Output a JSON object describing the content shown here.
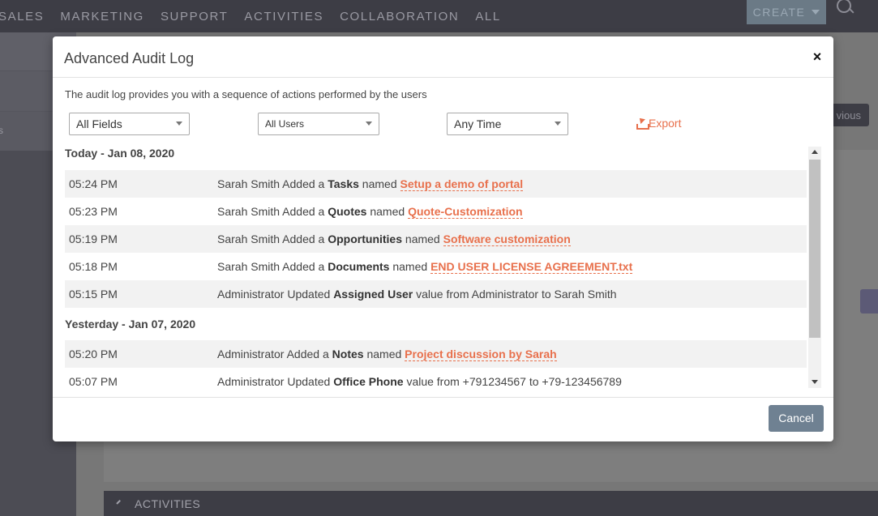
{
  "topnav": {
    "items": [
      "SALES",
      "MARKETING",
      "SUPPORT",
      "ACTIVITIES",
      "COLLABORATION",
      "ALL"
    ],
    "create_label": "CREATE"
  },
  "sidebar": {
    "partial_label": "s"
  },
  "background": {
    "prev_label": "vious",
    "activities_label": "ACTIVITIES"
  },
  "modal": {
    "title": "Advanced Audit Log",
    "close_label": "×",
    "description": "The audit log provides you with a sequence of actions performed by the users",
    "filters": {
      "fields": "All Fields",
      "users": "All Users",
      "time": "Any Time"
    },
    "export_label": "Export",
    "cancel_label": "Cancel",
    "days": [
      {
        "heading": "Today - Jan 08, 2020",
        "entries": [
          {
            "time": "05:24 PM",
            "actor": "Sarah Smith",
            "verb": "Added a",
            "module": "Tasks",
            "connector": "named",
            "link": "Setup a demo of portal"
          },
          {
            "time": "05:23 PM",
            "actor": "Sarah Smith",
            "verb": "Added a",
            "module": "Quotes",
            "connector": "named",
            "link": "Quote-Customization"
          },
          {
            "time": "05:19 PM",
            "actor": "Sarah Smith",
            "verb": "Added a",
            "module": "Opportunities",
            "connector": "named",
            "link": "Software customization"
          },
          {
            "time": "05:18 PM",
            "actor": "Sarah Smith",
            "verb": "Added a",
            "module": "Documents",
            "connector": "named",
            "link": "END USER LICENSE AGREEMENT.txt"
          },
          {
            "time": "05:15 PM",
            "actor": "Administrator",
            "verb": "Updated",
            "module": "Assigned User",
            "connector": "value from Administrator to Sarah Smith",
            "link": ""
          }
        ]
      },
      {
        "heading": "Yesterday - Jan 07, 2020",
        "entries": [
          {
            "time": "05:20 PM",
            "actor": "Administrator",
            "verb": "Added a",
            "module": "Notes",
            "connector": "named",
            "link": "Project discussion by Sarah"
          },
          {
            "time": "05:07 PM",
            "actor": "Administrator",
            "verb": "Updated",
            "module": "Office Phone",
            "connector": "value from +791234567 to +79-123456789",
            "link": ""
          }
        ]
      }
    ]
  },
  "colors": {
    "accent": "#e8704c",
    "cancel_button": "#6f8192",
    "topnav": "#3d3d45"
  }
}
